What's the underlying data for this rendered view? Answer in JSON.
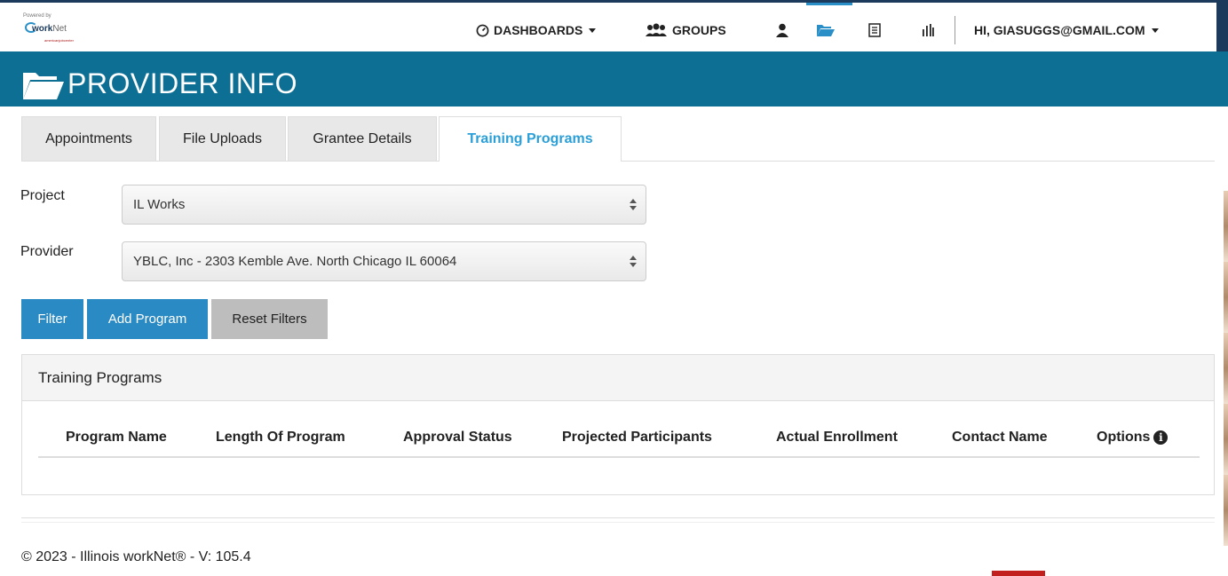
{
  "logo": {
    "powered_text": "Powered by",
    "wordmark": "work",
    "wordmark_suffix": "Net",
    "tagline": "americanjobcenter"
  },
  "topnav": {
    "dashboards_label": "DASHBOARDS",
    "groups_label": "GROUPS",
    "account_label": "HI, GIASUGGS@GMAIL.COM",
    "active_color": "#2a8fc7"
  },
  "banner": {
    "title": "PROVIDER INFO",
    "background": "#0d6f94"
  },
  "tabs": [
    {
      "label": "Appointments",
      "active": false
    },
    {
      "label": "File Uploads",
      "active": false
    },
    {
      "label": "Grantee Details",
      "active": false
    },
    {
      "label": "Training Programs",
      "active": true
    }
  ],
  "filters": {
    "project_label": "Project",
    "project_value": "IL Works",
    "provider_label": "Provider",
    "provider_value": "YBLC, Inc - 2303 Kemble Ave. North Chicago IL 60064"
  },
  "buttons": {
    "filter": "Filter",
    "add_program": "Add Program",
    "reset_filters": "Reset Filters"
  },
  "panel": {
    "title": "Training Programs",
    "columns": [
      "Program Name",
      "Length Of Program",
      "Approval Status",
      "Projected Participants",
      "Actual Enrollment",
      "Contact Name",
      "Options"
    ],
    "rows": []
  },
  "footer": {
    "text": "© 2023 - Illinois workNet® - V: 105.4"
  }
}
